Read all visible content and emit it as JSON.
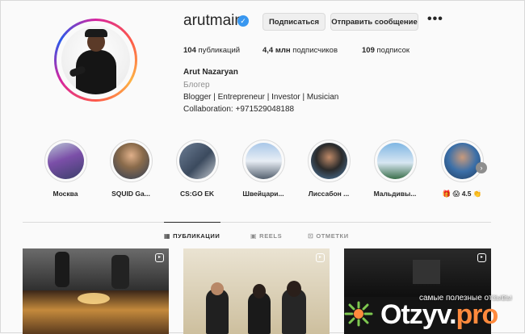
{
  "profile": {
    "username": "arutmain",
    "verified_icon": "verified-badge-icon",
    "follow_label": "Подписаться",
    "message_label": "Отправить сообщение",
    "more_label": "•••",
    "stats": {
      "posts_value": "104",
      "posts_label": "публикаций",
      "followers_value": "4,4 млн",
      "followers_label": "подписчиков",
      "following_value": "109",
      "following_label": "подписок"
    },
    "full_name": "Arut Nazaryan",
    "category": "Блогер",
    "bio_line": "Blogger | Entrepreneur | Investor | Musician",
    "collaboration": "Collaboration: +971529048188"
  },
  "highlights": [
    {
      "label": "Москва"
    },
    {
      "label": "SQUID Ga..."
    },
    {
      "label": "CS:GO EK"
    },
    {
      "label": "Швейцари..."
    },
    {
      "label": "Лиссабон ..."
    },
    {
      "label": "Мальдивы..."
    },
    {
      "label": "🎁 😱 4.5 👏"
    }
  ],
  "highlights_next_icon": "chevron-right-icon",
  "tabs": [
    {
      "label": "ПУБЛИКАЦИИ",
      "icon": "grid-icon",
      "active": true
    },
    {
      "label": "REELS",
      "icon": "reels-icon",
      "active": false
    },
    {
      "label": "ОТМЕТКИ",
      "icon": "tag-icon",
      "active": false
    }
  ],
  "posts": [
    {
      "type": "reel",
      "icon": "reel-icon"
    },
    {
      "type": "reel",
      "icon": "reel-icon"
    },
    {
      "type": "reel",
      "icon": "reel-icon"
    }
  ],
  "watermark": {
    "tagline": "самые полезные отзывы",
    "brand_main": "Otzyv.",
    "brand_accent": "pro"
  },
  "colors": {
    "verified": "#3897f0",
    "ring_gradient": [
      "#d6249f",
      "#fd5949",
      "#fdb244",
      "#285aeb"
    ],
    "watermark_accent": "#ff8a3d"
  }
}
